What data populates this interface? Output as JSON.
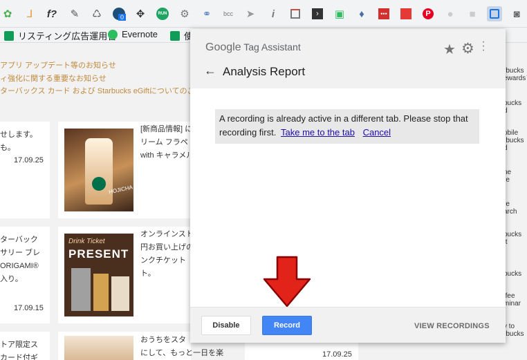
{
  "popup": {
    "brand_google": "Google",
    "brand_product": "Tag Assistant",
    "report_title": "Analysis Report",
    "message": "A recording is already active in a different tab. Please stop that recording first.",
    "link_take_me": "Take me to the tab",
    "link_cancel": "Cancel",
    "btn_disable": "Disable",
    "btn_record": "Record",
    "btn_view": "VIEW RECORDINGS",
    "arrow_color": "#e2231a"
  },
  "toolbar": {
    "badge": "0",
    "bcc_label": "bcc",
    "fx_label": "f?",
    "run_label": "RUN",
    "ext_icons": [
      "clover-icon",
      "bookmark-icon",
      "formula-icon",
      "eyedropper-icon",
      "recycle-icon",
      "tag-badge-icon",
      "move-icon",
      "run-icon",
      "gear-box-icon",
      "link-icon",
      "bcc-icon",
      "cursor-icon",
      "info-icon",
      "window-icon",
      "code-icon",
      "evernote-clip-icon",
      "drop-icon",
      "dots-icon",
      "checklist-icon",
      "pinterest-icon",
      "chat-icon",
      "camera-gray-icon",
      "tag-assistant-icon",
      "camera-icon"
    ]
  },
  "bookmarks": [
    {
      "label": "リスティング広告運用管",
      "color": "#0f9d58"
    },
    {
      "label": "Evernote",
      "color": "#2dbe60"
    },
    {
      "label": "使",
      "color": "#0f9d58"
    }
  ],
  "page": {
    "news": [
      "アプリ アップデート等のお知らせ",
      "ィ強化に関する重要なお知らせ",
      "ターバックス カード および Starbucks eGiftについてのご"
    ],
    "cards": [
      {
        "lines": [
          "せします。",
          "も。"
        ],
        "date": "17.09.25"
      },
      {
        "lines": [
          "[新商品情報] に",
          "リーム フラペ",
          "with キャラメル"
        ],
        "date": ""
      },
      {
        "lines": [
          "ターバック",
          "サリー ブレ",
          "ORIGAMI®",
          "入り。"
        ],
        "date": "17.09.15"
      },
      {
        "lines": [
          "オンラインスト",
          "円お買い上げの",
          "ンクチケット",
          "ト。"
        ],
        "date": ""
      },
      {
        "lines": [
          "トア限定ス",
          "カード付ギ"
        ],
        "date": ""
      },
      {
        "lines": [
          "おうちをスタ",
          "にして、もっと一日を楽"
        ],
        "date": "17.09.25"
      }
    ],
    "promo_label_1": "HOJICHA",
    "promo_label_2": "Drink Ticket",
    "promo_label_3": "PRESENT",
    "side_items": [
      [
        "rbucks",
        "ewards™"
      ],
      [
        "bucks",
        "d"
      ],
      [
        "obile",
        "rbucks",
        "d"
      ],
      [
        "ne",
        "re"
      ],
      [
        "re",
        "arch"
      ],
      [
        "bucks",
        "ft"
      ],
      [
        "bucks"
      ],
      [
        "ffee",
        "minar"
      ],
      [
        "y to",
        "rbucks"
      ]
    ]
  }
}
